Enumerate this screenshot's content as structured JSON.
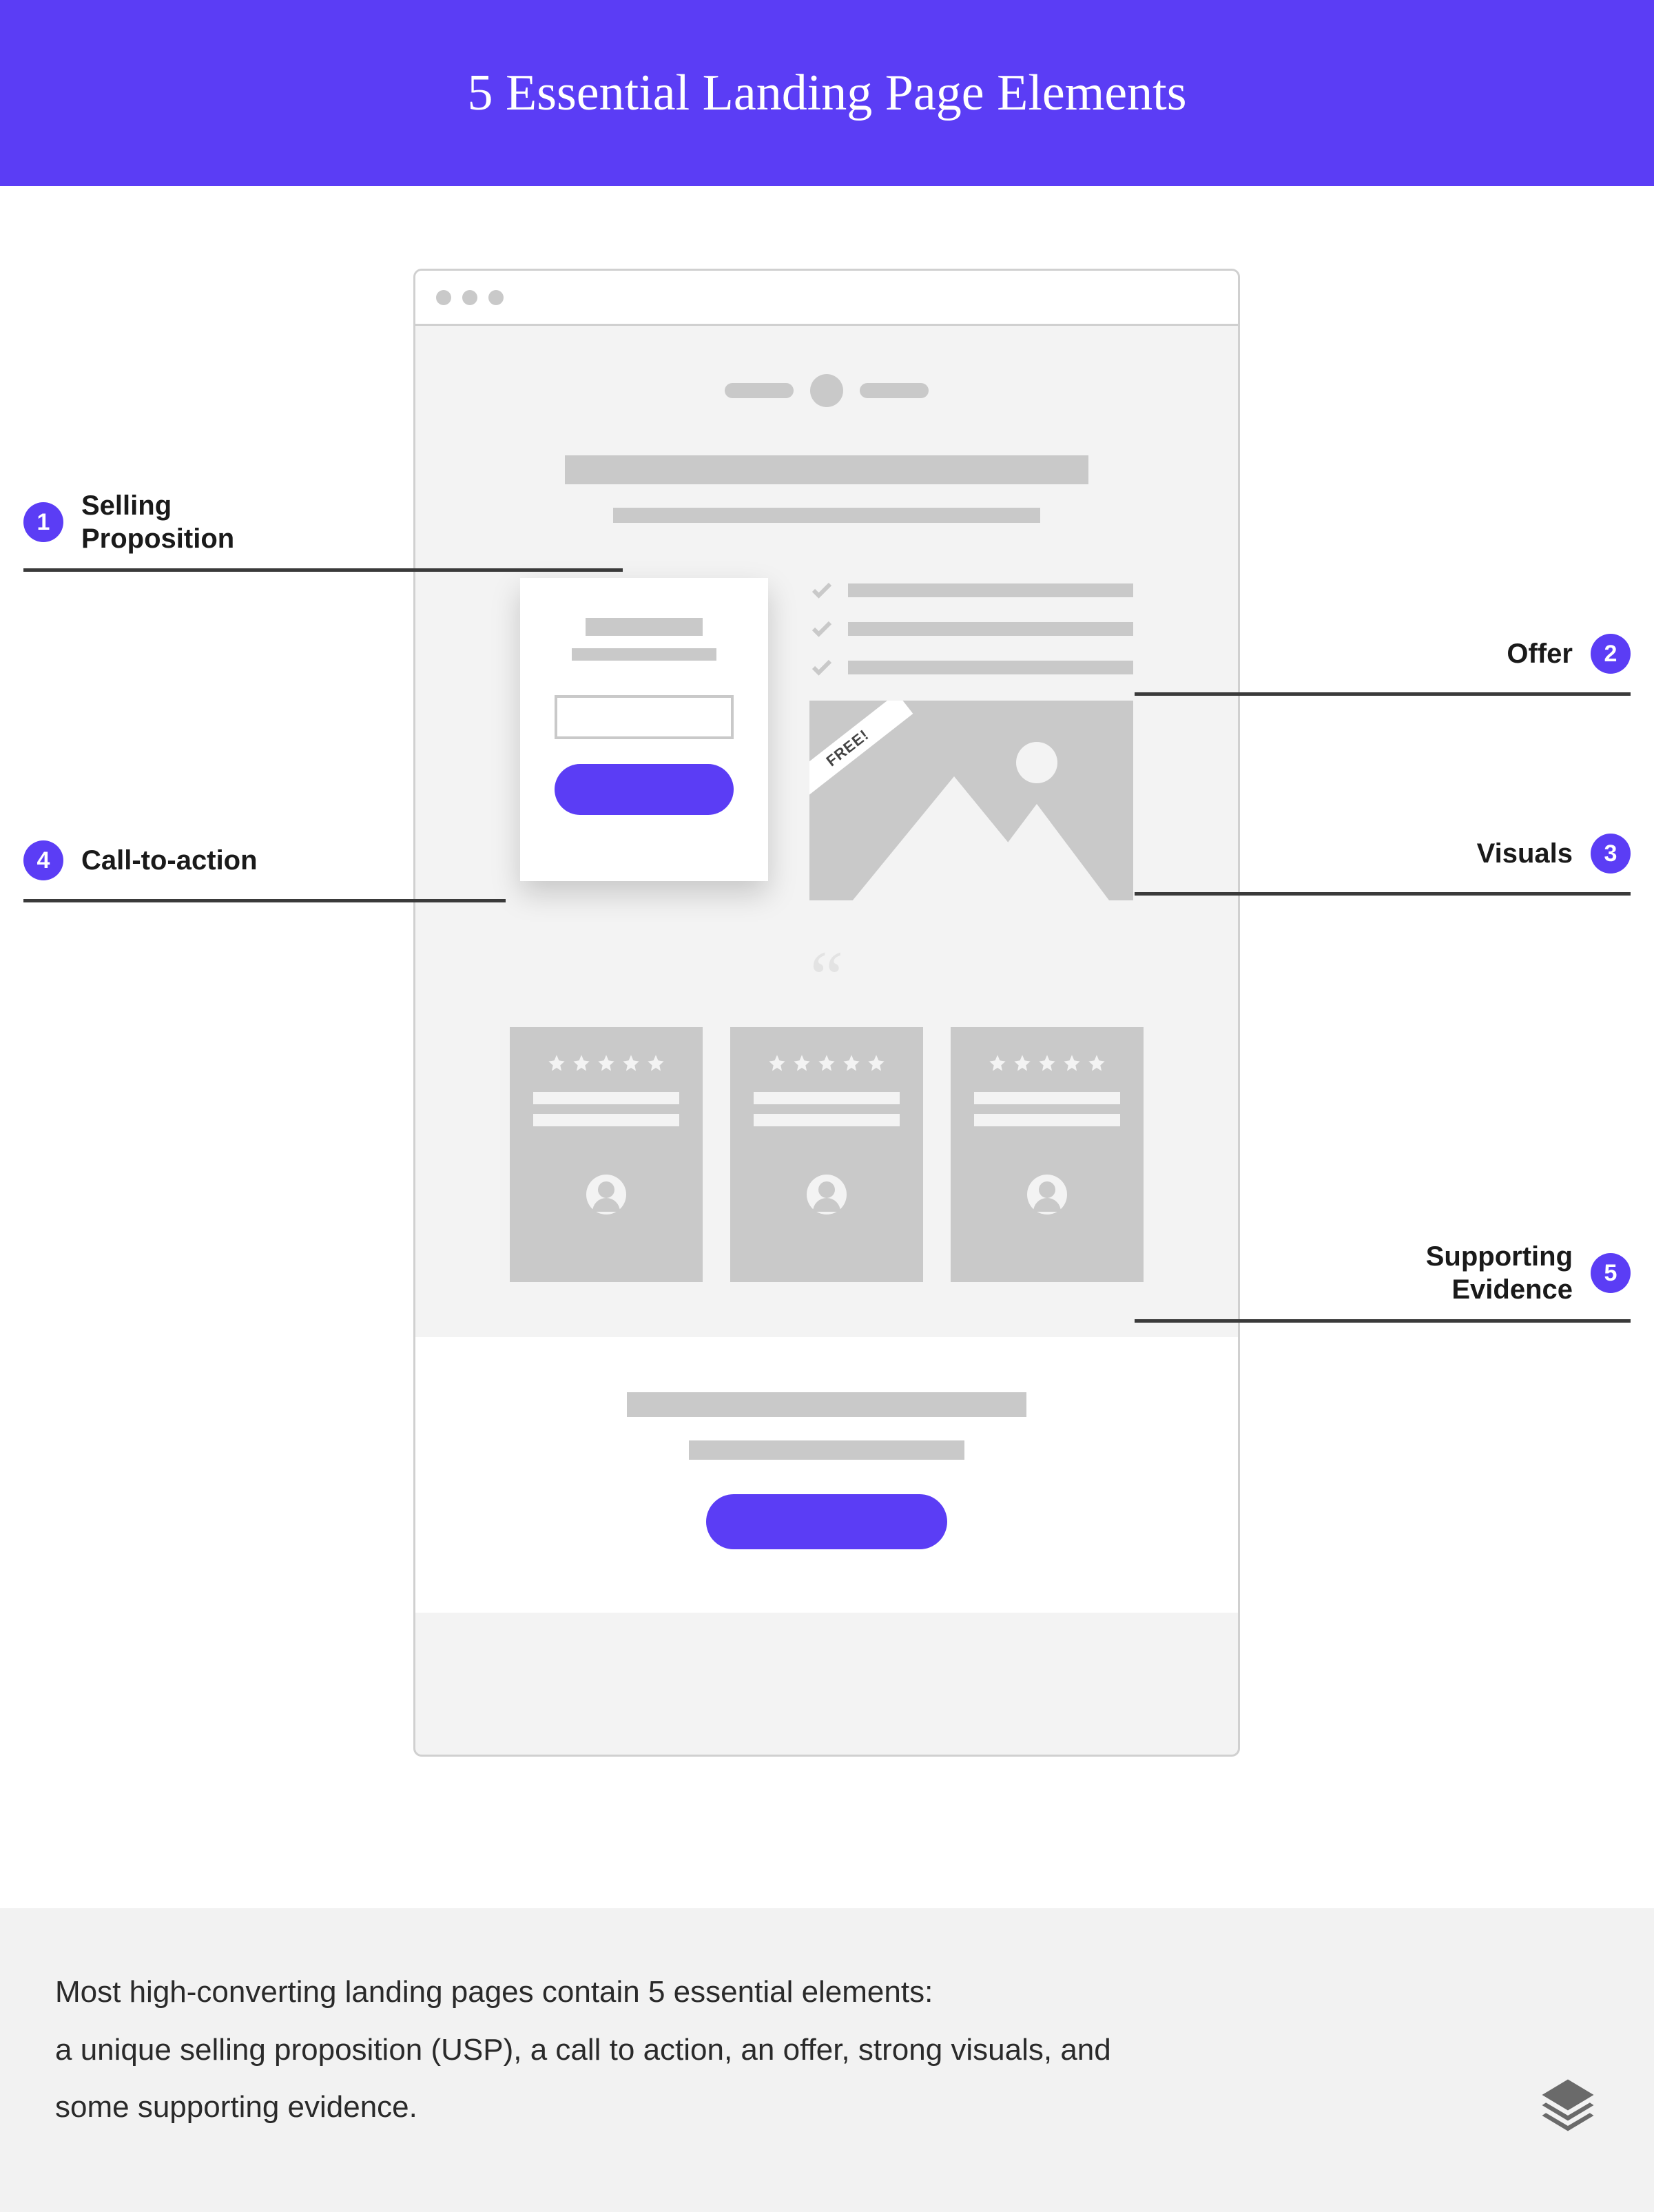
{
  "title": "5 Essential Landing Page Elements",
  "labels": {
    "l1": {
      "num": "1",
      "text": "Selling\nProposition"
    },
    "l2": {
      "num": "2",
      "text": "Offer"
    },
    "l3": {
      "num": "3",
      "text": "Visuals"
    },
    "l4": {
      "num": "4",
      "text": "Call-to-action"
    },
    "l5": {
      "num": "5",
      "text": "Supporting\nEvidence"
    }
  },
  "ribbon": "FREE!",
  "caption": " Most high-converting landing pages contain 5 essential elements:\na unique selling proposition (USP), a call to action, an offer, strong visuals, and\nsome supporting evidence."
}
